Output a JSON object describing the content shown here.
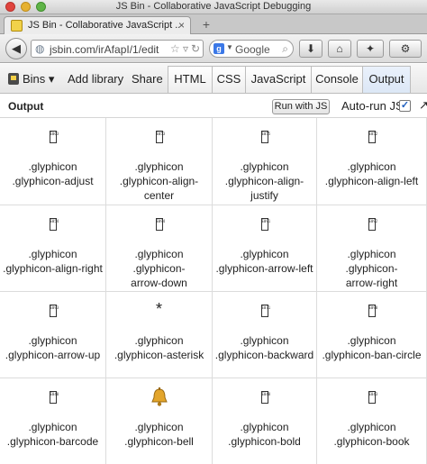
{
  "window": {
    "title": "JS Bin - Collaborative JavaScript Debugging"
  },
  "tab": {
    "label": "JS Bin - Collaborative JavaScript ...",
    "close_glyph": "×",
    "new_tab_glyph": "+"
  },
  "nav": {
    "back_glyph": "◀",
    "url": "jsbin.com/irAfapI/1/edit",
    "search_placeholder": "Google",
    "search_engine_letter": "g",
    "download_glyph": "⬇",
    "home_glyph": "⌂",
    "bookmark_glyph": "✦",
    "tools_glyph": "⚙"
  },
  "jsbin_toolbar": {
    "bins_label": "Bins ▾",
    "add_library_label": "Add library",
    "share_label": "Share",
    "panels": [
      {
        "label": "HTML",
        "active": false
      },
      {
        "label": "CSS",
        "active": false
      },
      {
        "label": "JavaScript",
        "active": false
      },
      {
        "label": "Console",
        "active": false
      },
      {
        "label": "Output",
        "active": true
      }
    ]
  },
  "output_header": {
    "title": "Output",
    "run_button": "Run with JS",
    "autorun_label": "Auto-run JS",
    "autorun_checked": true,
    "check_glyph": "✓",
    "more_glyph": "↗"
  },
  "glyphicons": [
    {
      "line1": ".glyphicon",
      "line2": ".glyphicon-adjust",
      "line3": "",
      "icon": "missing-glyph-box",
      "code": "E063"
    },
    {
      "line1": ".glyphicon",
      "line2": ".glyphicon-align-",
      "line3": "center",
      "icon": "missing-glyph-box",
      "code": "E053"
    },
    {
      "line1": ".glyphicon",
      "line2": ".glyphicon-align-",
      "line3": "justify",
      "icon": "missing-glyph-box",
      "code": "E055"
    },
    {
      "line1": ".glyphicon",
      "line2": ".glyphicon-align-left",
      "line3": "",
      "icon": "missing-glyph-box",
      "code": "E052"
    },
    {
      "line1": ".glyphicon",
      "line2": ".glyphicon-align-right",
      "line3": "",
      "icon": "missing-glyph-box",
      "code": "E054"
    },
    {
      "line1": ".glyphicon",
      "line2": ".glyphicon-",
      "line3": "arrow-down",
      "icon": "missing-glyph-box",
      "code": "E094"
    },
    {
      "line1": ".glyphicon",
      "line2": ".glyphicon-arrow-left",
      "line3": "",
      "icon": "missing-glyph-box",
      "code": "E091"
    },
    {
      "line1": ".glyphicon",
      "line2": ".glyphicon-",
      "line3": "arrow-right",
      "icon": "missing-glyph-box",
      "code": "E092"
    },
    {
      "line1": ".glyphicon",
      "line2": ".glyphicon-arrow-up",
      "line3": "",
      "icon": "missing-glyph-box",
      "code": "E093"
    },
    {
      "line1": ".glyphicon",
      "line2": ".glyphicon-asterisk",
      "line3": "",
      "icon": "asterisk-icon",
      "symbol": "*"
    },
    {
      "line1": ".glyphicon",
      "line2": ".glyphicon-backward",
      "line3": "",
      "icon": "missing-glyph-box",
      "code": "E071"
    },
    {
      "line1": ".glyphicon",
      "line2": ".glyphicon-ban-circle",
      "line3": "",
      "icon": "missing-glyph-box",
      "code": "E090"
    },
    {
      "line1": ".glyphicon",
      "line2": ".glyphicon-barcode",
      "line3": "",
      "icon": "missing-glyph-box",
      "code": "E040"
    },
    {
      "line1": ".glyphicon",
      "line2": ".glyphicon-bell",
      "line3": "",
      "icon": "bell-icon",
      "symbol": "bell"
    },
    {
      "line1": ".glyphicon",
      "line2": ".glyphicon-bold",
      "line3": "",
      "icon": "missing-glyph-box",
      "code": "E048"
    },
    {
      "line1": ".glyphicon",
      "line2": ".glyphicon-book",
      "line3": "",
      "icon": "missing-glyph-box",
      "code": "E043"
    }
  ],
  "colors": {
    "active_panel": "#dce7f6",
    "bell": "#e3a52b",
    "close": "#e0443e",
    "minimize": "#e6b131",
    "maximize": "#5fb447"
  }
}
